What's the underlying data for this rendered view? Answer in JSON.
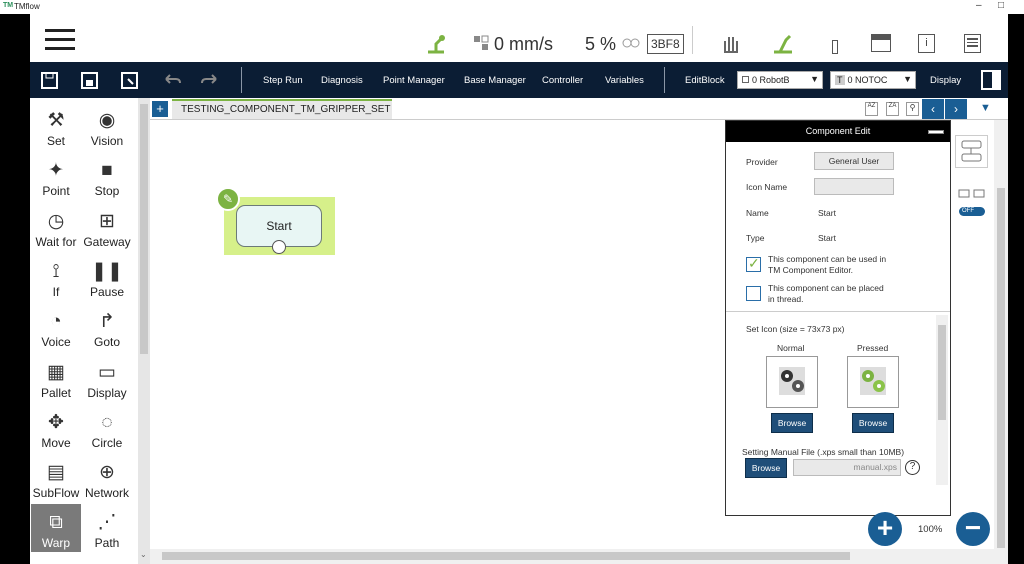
{
  "window": {
    "logo": "TM",
    "title": "TMflow",
    "minimize": "–",
    "maximize": "□"
  },
  "topbar": {
    "speed": "0 mm/s",
    "percent": "5 %",
    "code": "3BF8"
  },
  "toolbar": {
    "items": [
      "Step Run",
      "Diagnosis",
      "Point Manager",
      "Base Manager",
      "Controller",
      "Variables",
      "EditBlock"
    ],
    "robot_select": "0 RobotB",
    "tool_select_prefix": "T",
    "tool_select": "0 NOTOC",
    "display": "Display"
  },
  "left_tools": [
    {
      "label": "Set",
      "icon": "wrench-icon"
    },
    {
      "label": "Vision",
      "icon": "eye-icon"
    },
    {
      "label": "Point",
      "icon": "point-icon"
    },
    {
      "label": "Stop",
      "icon": "stop-icon"
    },
    {
      "label": "Wait for",
      "icon": "clock-icon"
    },
    {
      "label": "Gateway",
      "icon": "gateway-icon"
    },
    {
      "label": "If",
      "icon": "if-icon"
    },
    {
      "label": "Pause",
      "icon": "pause-icon"
    },
    {
      "label": "Voice",
      "icon": "voice-icon"
    },
    {
      "label": "Goto",
      "icon": "goto-icon"
    },
    {
      "label": "Pallet",
      "icon": "pallet-icon"
    },
    {
      "label": "Display",
      "icon": "display-icon"
    },
    {
      "label": "Move",
      "icon": "move-icon"
    },
    {
      "label": "Circle",
      "icon": "circle-icon"
    },
    {
      "label": "SubFlow",
      "icon": "subflow-icon"
    },
    {
      "label": "Network",
      "icon": "network-icon"
    },
    {
      "label": "Warp",
      "icon": "warp-icon"
    },
    {
      "label": "Path",
      "icon": "path-icon"
    }
  ],
  "tab": {
    "plus": "+",
    "name": "TESTING_COMPONENT_TM_GRIPPER_SET"
  },
  "flow": {
    "start_node": "Start"
  },
  "component_edit": {
    "title": "Component Edit",
    "provider_label": "Provider",
    "provider_value": "General User",
    "icon_name_label": "Icon Name",
    "icon_name_value": "",
    "name_label": "Name",
    "name_value": "Start",
    "type_label": "Type",
    "type_value": "Start",
    "check1_line1": "This component can be used in",
    "check1_line2": "TM Component Editor.",
    "check1_checked": true,
    "check2_line1": "This component can be placed",
    "check2_line2": "in thread.",
    "check2_checked": false,
    "set_icon_label": "Set Icon (size = 73x73 px)",
    "normal_label": "Normal",
    "pressed_label": "Pressed",
    "browse_label": "Browse",
    "manual_label": "Setting Manual File (.xps small than 10MB)",
    "manual_placeholder": "manual.xps",
    "help": "?"
  },
  "right_side": {
    "toggle_label": "OFF"
  },
  "zoom": {
    "level": "100%",
    "plus": "+",
    "minus": "−"
  },
  "colors": {
    "toolbar_bg": "#0b1d34",
    "accent_blue": "#1f4e79",
    "start_highlight": "#d6f08a",
    "edit_green": "#7cb342"
  }
}
